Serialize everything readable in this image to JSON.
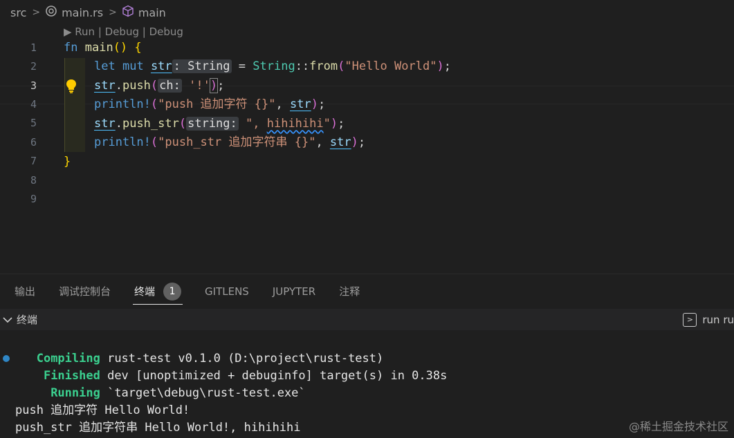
{
  "breadcrumb": {
    "folder": "src",
    "file": "main.rs",
    "symbol": "main",
    "file_icon": "rust-file-icon",
    "symbol_icon": "cube-icon"
  },
  "editor": {
    "codelens": "▶ Run | Debug | Debug",
    "line_numbers": [
      "1",
      "2",
      "3",
      "4",
      "5",
      "6",
      "7",
      "8",
      "9"
    ],
    "active_line": 3,
    "lines": {
      "l1": {
        "fn": "fn",
        "name": "main",
        "paren": "()",
        "brace": "{"
      },
      "l2": {
        "let": "let",
        "mut": "mut",
        "var": "str",
        "hint": ": String",
        "eq": " = ",
        "type": "String",
        "sep": "::",
        "call": "from",
        "open": "(",
        "arg": "\"Hello World\"",
        "close": ")",
        "end": ";"
      },
      "l3": {
        "var": "str",
        "dot": ".",
        "call": "push",
        "open": "(",
        "hint": "ch:",
        "arg": " '!'",
        "close": ")",
        "end": ";"
      },
      "l4": {
        "mac": "println!",
        "open": "(",
        "arg": "\"push 追加字符 {}\"",
        "comma": ", ",
        "var": "str",
        "close": ")",
        "end": ";"
      },
      "l5": {
        "var": "str",
        "dot": ".",
        "call": "push_str",
        "open": "(",
        "hint": "string:",
        "arg": " \", ",
        "squig": "hihihihi",
        "arg2": "\"",
        "close": ")",
        "end": ";"
      },
      "l6": {
        "mac": "println!",
        "open": "(",
        "arg": "\"push_str 追加字符串 {}\"",
        "comma": ", ",
        "var": "str",
        "close": ")",
        "end": ";"
      },
      "l7": {
        "brace": "}"
      }
    }
  },
  "panel": {
    "tabs": [
      "输出",
      "调试控制台",
      "终端",
      "GITLENS",
      "JUPYTER",
      "注释"
    ],
    "active_tab": "终端",
    "badge": "1",
    "terminal_title": "终端",
    "task_label": "run ru"
  },
  "terminal": {
    "l1_status": "Compiling",
    "l1_text": " rust-test v0.1.0 (D:\\project\\rust-test)",
    "l2_status": "Finished",
    "l2_text": " dev [unoptimized + debuginfo] target(s) in 0.38s",
    "l3_status": "Running",
    "l3_text": " `target\\debug\\rust-test.exe`",
    "l4": "push 追加字符 Hello World!",
    "l5": "push_str 追加字符串 Hello World!, hihihihi"
  },
  "watermark": "@稀土掘金技术社区",
  "colors": {
    "background": "#1f1f1f",
    "keyword": "#569cd6",
    "function": "#dcdcaa",
    "variable": "#9cdcfe",
    "type": "#4ec9b0",
    "string": "#ce9178",
    "terminal_green": "#3bd08f"
  }
}
